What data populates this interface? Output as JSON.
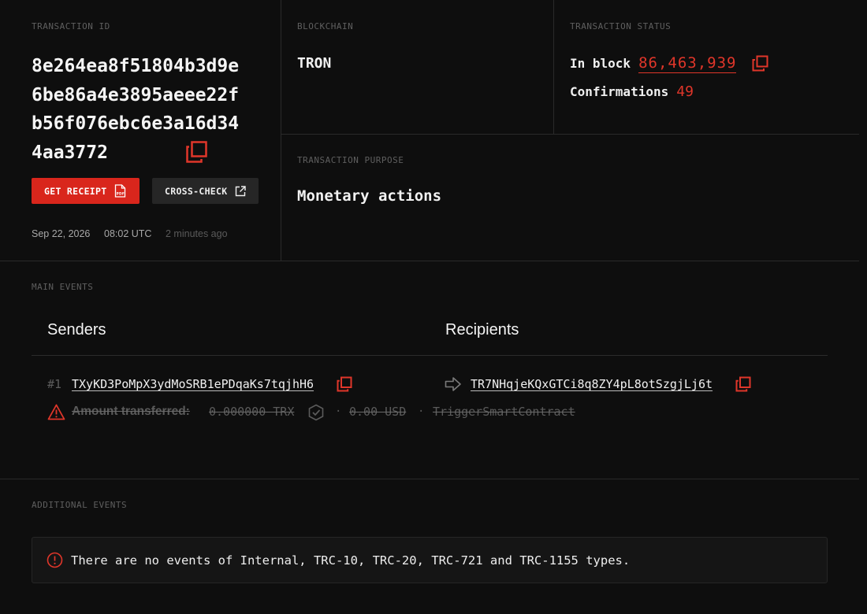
{
  "transaction_id": {
    "label": "TRANSACTION ID",
    "value": "8e264ea8f51804b3d9e6be86a4e3895aeee22fb56f076ebc6e3a16d344aa3772",
    "buttons": {
      "receipt": "GET RECEIPT",
      "cross_check": "CROSS-CHECK"
    },
    "date": "Sep 22, 2026",
    "time": "08:02 UTC",
    "ago": "2 minutes ago"
  },
  "blockchain": {
    "label": "BLOCKCHAIN",
    "value": "TRON"
  },
  "status": {
    "label": "TRANSACTION STATUS",
    "in_block_label": "In block",
    "block_number": "86,463,939",
    "confirmations_label": "Confirmations",
    "confirmations": "49"
  },
  "purpose": {
    "label": "TRANSACTION PURPOSE",
    "value": "Monetary actions"
  },
  "main_events": {
    "label": "MAIN EVENTS",
    "senders_header": "Senders",
    "recipients_header": "Recipients",
    "row": {
      "index": "#1",
      "sender": "TXyKD3PoMpX3ydMoSRB1ePDqaKs7tqjhH6",
      "recipient": "TR7NHqjeKQxGTCi8q8ZY4pL8otSzgjLj6t",
      "amount_label": "Amount transferred:",
      "amount": "0.000000 TRX",
      "usd": "0.00 USD",
      "contract_type": "TriggerSmartContract"
    }
  },
  "additional_events": {
    "label": "ADDITIONAL EVENTS",
    "notice": "There are no events of Internal, TRC-10, TRC-20, TRC-721 and TRC-1155 types."
  },
  "colors": {
    "accent": "#d9261c",
    "background": "#0e0e0e",
    "border": "#2a2a2a"
  },
  "icons": [
    "copy-icon",
    "pdf-icon",
    "external-link-icon",
    "arrow-right-icon",
    "warning-icon",
    "verified-icon",
    "info-icon"
  ]
}
